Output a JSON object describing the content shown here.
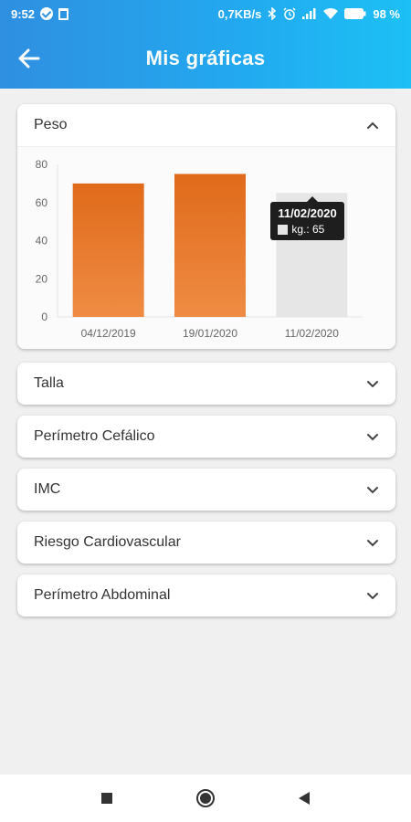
{
  "status_bar": {
    "time": "9:52",
    "network_speed": "0,7KB/s",
    "battery": "98 %",
    "icons": [
      "check-circle-icon",
      "trash-icon",
      "bluetooth-icon",
      "alarm-icon",
      "signal-icon",
      "wifi-icon",
      "battery-icon"
    ]
  },
  "app_bar": {
    "title": "Mis gráficas",
    "back_icon": "arrow-left-icon"
  },
  "colors": {
    "header_gradient_start": "#2f8fe0",
    "header_gradient_end": "#1cc0f5",
    "bar_color": "#e06a1a",
    "bar_inactive": "#e6e6e6"
  },
  "sections": [
    {
      "label": "Peso",
      "expanded": true,
      "chevron": "chevron-up-icon"
    },
    {
      "label": "Talla",
      "expanded": false,
      "chevron": "chevron-down-icon"
    },
    {
      "label": "Perímetro Cefálico",
      "expanded": false,
      "chevron": "chevron-down-icon"
    },
    {
      "label": "IMC",
      "expanded": false,
      "chevron": "chevron-down-icon"
    },
    {
      "label": "Riesgo Cardiovascular",
      "expanded": false,
      "chevron": "chevron-down-icon"
    },
    {
      "label": "Perímetro Abdominal",
      "expanded": false,
      "chevron": "chevron-down-icon"
    }
  ],
  "chart_data": {
    "type": "bar",
    "categories": [
      "04/12/2019",
      "19/01/2020",
      "11/02/2020"
    ],
    "values": [
      70,
      75,
      65
    ],
    "ylim": [
      0,
      80
    ],
    "yticks": [
      0,
      20,
      40,
      60,
      80
    ],
    "highlighted_index": 2,
    "tooltip": {
      "title": "11/02/2020",
      "label": "kg.: 65"
    }
  },
  "nav_bar": {
    "buttons": [
      "square-recents-icon",
      "circle-home-icon",
      "triangle-back-icon"
    ]
  }
}
